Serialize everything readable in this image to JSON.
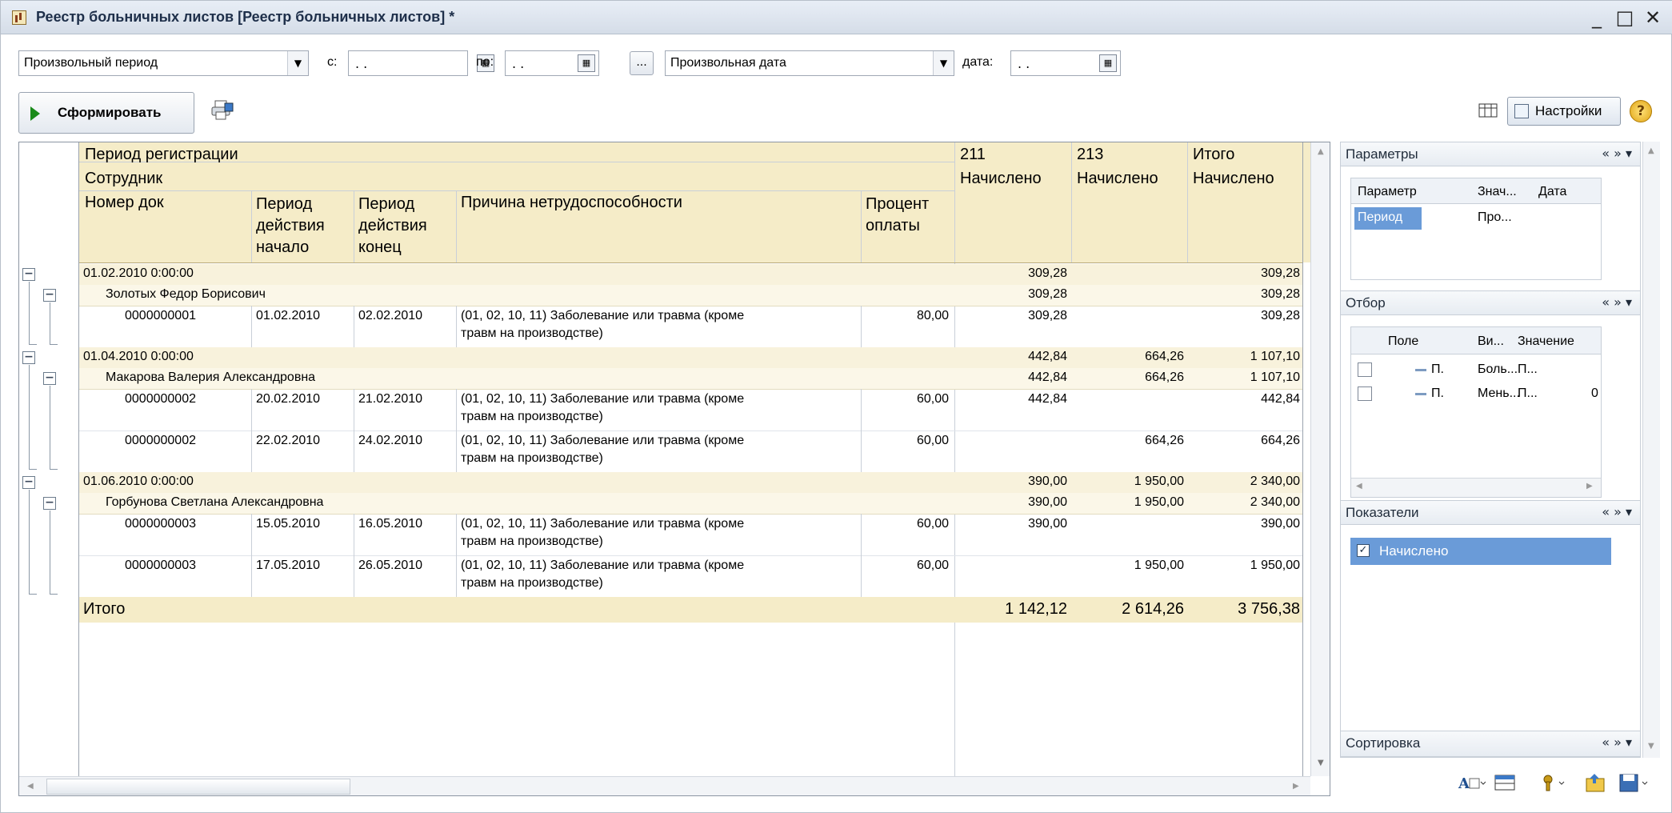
{
  "window": {
    "title": "Реестр больничных листов [Реестр больничных листов] *",
    "minimize": "_",
    "maximize": "□",
    "close": "✕"
  },
  "filters": {
    "period_kind": "Произвольный период",
    "from_label": "с:",
    "from_value": ". .",
    "to_label": "по:",
    "to_value": ". .",
    "ellipsis": "...",
    "date_kind": "Произвольная дата",
    "date_label": "дата:",
    "date_value": ". ."
  },
  "toolbar": {
    "form_button": "Сформировать",
    "settings_button": "Настройки",
    "help": "?"
  },
  "report": {
    "headers": {
      "period": "Период регистрации",
      "employee": "Сотрудник",
      "doc_num": "Номер док",
      "start": [
        "Период",
        "действия",
        "начало"
      ],
      "end": [
        "Период",
        "действия",
        "конец"
      ],
      "reason": "Причина нетрудоспособности",
      "percent": [
        "Процент",
        "оплаты"
      ],
      "col211": "211",
      "col213": "213",
      "total": "Итого",
      "accrued": "Начислено"
    },
    "groups": [
      {
        "period": "01.02.2010 0:00:00",
        "c211": "309,28",
        "c213": "",
        "total": "309,28",
        "employee": {
          "name": "Золотых Федор Борисович",
          "c211": "309,28",
          "c213": "",
          "total": "309,28"
        },
        "docs": [
          {
            "num": "0000000001",
            "start": "01.02.2010",
            "end": "02.02.2010",
            "reason1": "(01, 02, 10, 11) Заболевание или травма (кроме",
            "reason2": "травм на производстве)",
            "pct": "80,00",
            "c211": "309,28",
            "c213": "",
            "total": "309,28"
          }
        ]
      },
      {
        "period": "01.04.2010 0:00:00",
        "c211": "442,84",
        "c213": "664,26",
        "total": "1 107,10",
        "employee": {
          "name": "Макарова Валерия  Александровна",
          "c211": "442,84",
          "c213": "664,26",
          "total": "1 107,10"
        },
        "docs": [
          {
            "num": "0000000002",
            "start": "20.02.2010",
            "end": "21.02.2010",
            "reason1": "(01, 02, 10, 11) Заболевание или травма (кроме",
            "reason2": "травм на производстве)",
            "pct": "60,00",
            "c211": "442,84",
            "c213": "",
            "total": "442,84"
          },
          {
            "num": "0000000002",
            "start": "22.02.2010",
            "end": "24.02.2010",
            "reason1": "(01, 02, 10, 11) Заболевание или травма (кроме",
            "reason2": "травм на производстве)",
            "pct": "60,00",
            "c211": "",
            "c213": "664,26",
            "total": "664,26"
          }
        ]
      },
      {
        "period": "01.06.2010 0:00:00",
        "c211": "390,00",
        "c213": "1 950,00",
        "total": "2 340,00",
        "employee": {
          "name": "Горбунова Светлана Александровна",
          "c211": "390,00",
          "c213": "1 950,00",
          "total": "2 340,00"
        },
        "docs": [
          {
            "num": "0000000003",
            "start": "15.05.2010",
            "end": "16.05.2010",
            "reason1": "(01, 02, 10, 11) Заболевание или травма (кроме",
            "reason2": "травм на производстве)",
            "pct": "60,00",
            "c211": "390,00",
            "c213": "",
            "total": "390,00"
          },
          {
            "num": "0000000003",
            "start": "17.05.2010",
            "end": "26.05.2010",
            "reason1": "(01, 02, 10, 11) Заболевание или травма (кроме",
            "reason2": "травм на производстве)",
            "pct": "60,00",
            "c211": "",
            "c213": "1 950,00",
            "total": "1 950,00"
          }
        ]
      }
    ],
    "grand_total": {
      "label": "Итого",
      "c211": "1 142,12",
      "c213": "2 614,26",
      "total": "3 756,38"
    }
  },
  "side": {
    "params": {
      "title": "Параметры",
      "col_param": "Параметр",
      "col_value": "Знач...",
      "col_date": "Дата",
      "row_param": "Период",
      "row_value": "Про..."
    },
    "filter": {
      "title": "Отбор",
      "col_field": "Поле",
      "col_kind": "Ви...",
      "col_value": "Значение",
      "rows": [
        {
          "field": "П.",
          "kind": "Боль...",
          "value": "П...",
          "extra": ""
        },
        {
          "field": "П.",
          "kind": "Мень...",
          "value": "П...",
          "extra": "0"
        }
      ]
    },
    "indicators": {
      "title": "Показатели",
      "item": "Начислено"
    },
    "sorting": {
      "title": "Сортировка"
    },
    "chevrons": "« » ▾"
  },
  "colors": {
    "header_bg": "#f5ecc8",
    "group_bg": "#f8f2dc",
    "selected": "#6a9bd8"
  }
}
